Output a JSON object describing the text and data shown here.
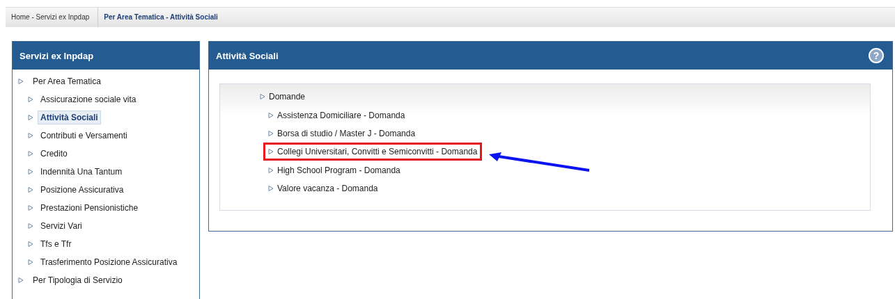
{
  "breadcrumb": [
    {
      "label": "Home - Servizi ex Inpdap",
      "selected": false
    },
    {
      "label": "Per Area Tematica - Attività Sociali",
      "selected": true
    }
  ],
  "sidebar": {
    "title": "Servizi ex Inpdap",
    "items": [
      {
        "label": "Per Area Tematica",
        "selected": false,
        "children": [
          {
            "label": "Assicurazione sociale vita",
            "selected": false
          },
          {
            "label": "Attività Sociali",
            "selected": true
          },
          {
            "label": "Contributi e Versamenti",
            "selected": false
          },
          {
            "label": "Credito",
            "selected": false
          },
          {
            "label": "Indennità Una Tantum",
            "selected": false
          },
          {
            "label": "Posizione Assicurativa",
            "selected": false
          },
          {
            "label": "Prestazioni Pensionistiche",
            "selected": false
          },
          {
            "label": "Servizi Vari",
            "selected": false
          },
          {
            "label": "Tfs e Tfr",
            "selected": false
          },
          {
            "label": "Trasferimento Posizione Assicurativa",
            "selected": false
          }
        ]
      },
      {
        "label": "Per Tipologia di Servizio",
        "selected": false
      }
    ]
  },
  "panel": {
    "title": "Attività Sociali",
    "help": "?",
    "items": [
      {
        "label": "Domande",
        "highlighted": false,
        "children": [
          {
            "label": "Assistenza Domiciliare - Domanda",
            "highlighted": false
          },
          {
            "label": "Borsa di studio / Master J - Domanda",
            "highlighted": false
          },
          {
            "label": "Collegi Universitari, Convitti e Semiconvitti - Domanda",
            "highlighted": true
          },
          {
            "label": "High School Program - Domanda",
            "highlighted": false
          },
          {
            "label": "Valore vacanza - Domanda",
            "highlighted": false
          }
        ]
      }
    ]
  }
}
